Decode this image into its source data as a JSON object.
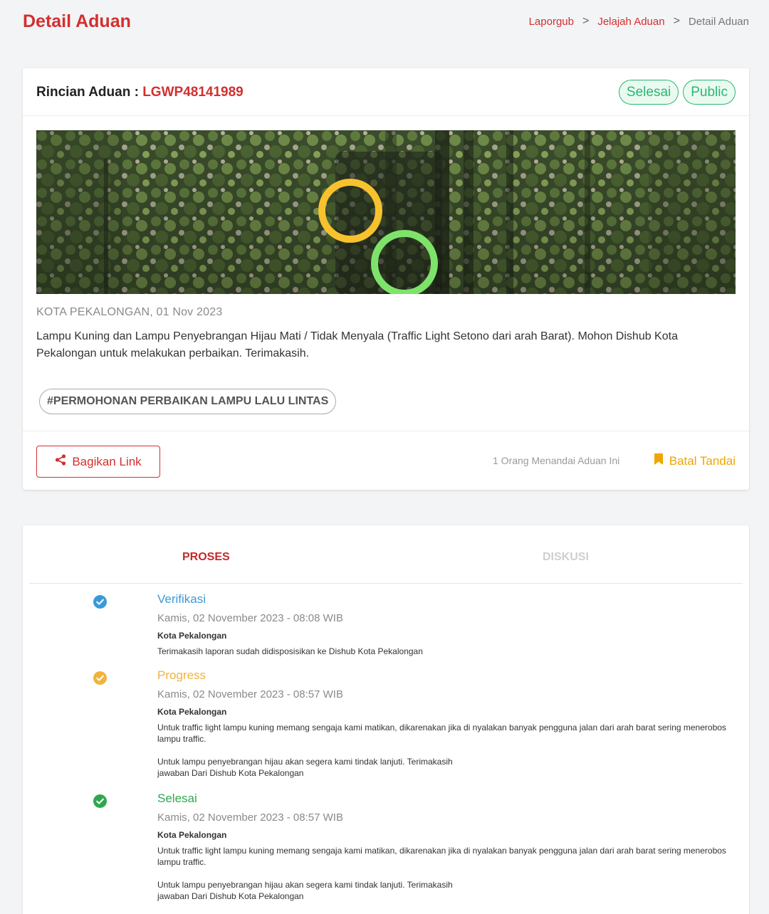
{
  "header": {
    "title": "Detail Aduan",
    "breadcrumb": {
      "home": "Laporgub",
      "sep1": ">",
      "explore": "Jelajah Aduan",
      "sep2": ">",
      "current": "Detail Aduan"
    }
  },
  "detail": {
    "heading_label": "Rincian Aduan : ",
    "code": "LGWP48141989",
    "badges": [
      "Selesai",
      "Public"
    ],
    "location_date": "KOTA PEKALONGAN, 01 Nov 2023",
    "description": "Lampu Kuning dan Lampu Penyebrangan Hijau Mati / Tidak Menyala (Traffic Light Setono dari arah Barat). Mohon Dishub Kota Pekalongan untuk melakukan perbaikan. Terimakasih.",
    "tag": "#PERMOHONAN PERBAIKAN LAMPU LALU LINTAS",
    "share_label": "Bagikan Link",
    "mark_count_text": "1 Orang Menandai Aduan Ini",
    "unmark_label": "Batal Tandai"
  },
  "tabs": {
    "process": "PROSES",
    "discussion": "DISKUSI"
  },
  "timeline": [
    {
      "title": "Verifikasi",
      "color": "#3a9ad9",
      "date": "Kamis, 02 November 2023 - 08:08 WIB",
      "org": "Kota Pekalongan",
      "message_p1": "Terimakasih laporan sudah didisposisikan ke Dishub Kota Pekalongan",
      "message_p2_line1": "",
      "message_p2_line2": ""
    },
    {
      "title": "Progress",
      "color": "#f2b33d",
      "date": "Kamis, 02 November 2023 - 08:57 WIB",
      "org": "Kota Pekalongan",
      "message_p1": "Untuk traffic light lampu kuning memang sengaja kami matikan, dikarenakan jika di nyalakan banyak pengguna jalan dari arah barat sering menerobos lampu traffic.",
      "message_p2_line1": "Untuk lampu penyebrangan hijau akan segera kami tindak lanjuti. Terimakasih",
      "message_p2_line2": "jawaban Dari Dishub Kota Pekalongan"
    },
    {
      "title": "Selesai",
      "color": "#2ea84f",
      "date": "Kamis, 02 November 2023 - 08:57 WIB",
      "org": "Kota Pekalongan",
      "message_p1": "Untuk traffic light lampu kuning memang sengaja kami matikan, dikarenakan jika di nyalakan banyak pengguna jalan dari arah barat sering menerobos lampu traffic.",
      "message_p2_line1": "Untuk lampu penyebrangan hijau akan segera kami tindak lanjuti. Terimakasih",
      "message_p2_line2": "jawaban Dari Dishub Kota Pekalongan"
    }
  ],
  "colors": {
    "brand_red": "#d32f2f",
    "success_green": "#2bb673",
    "bookmark_orange": "#f0a500"
  }
}
